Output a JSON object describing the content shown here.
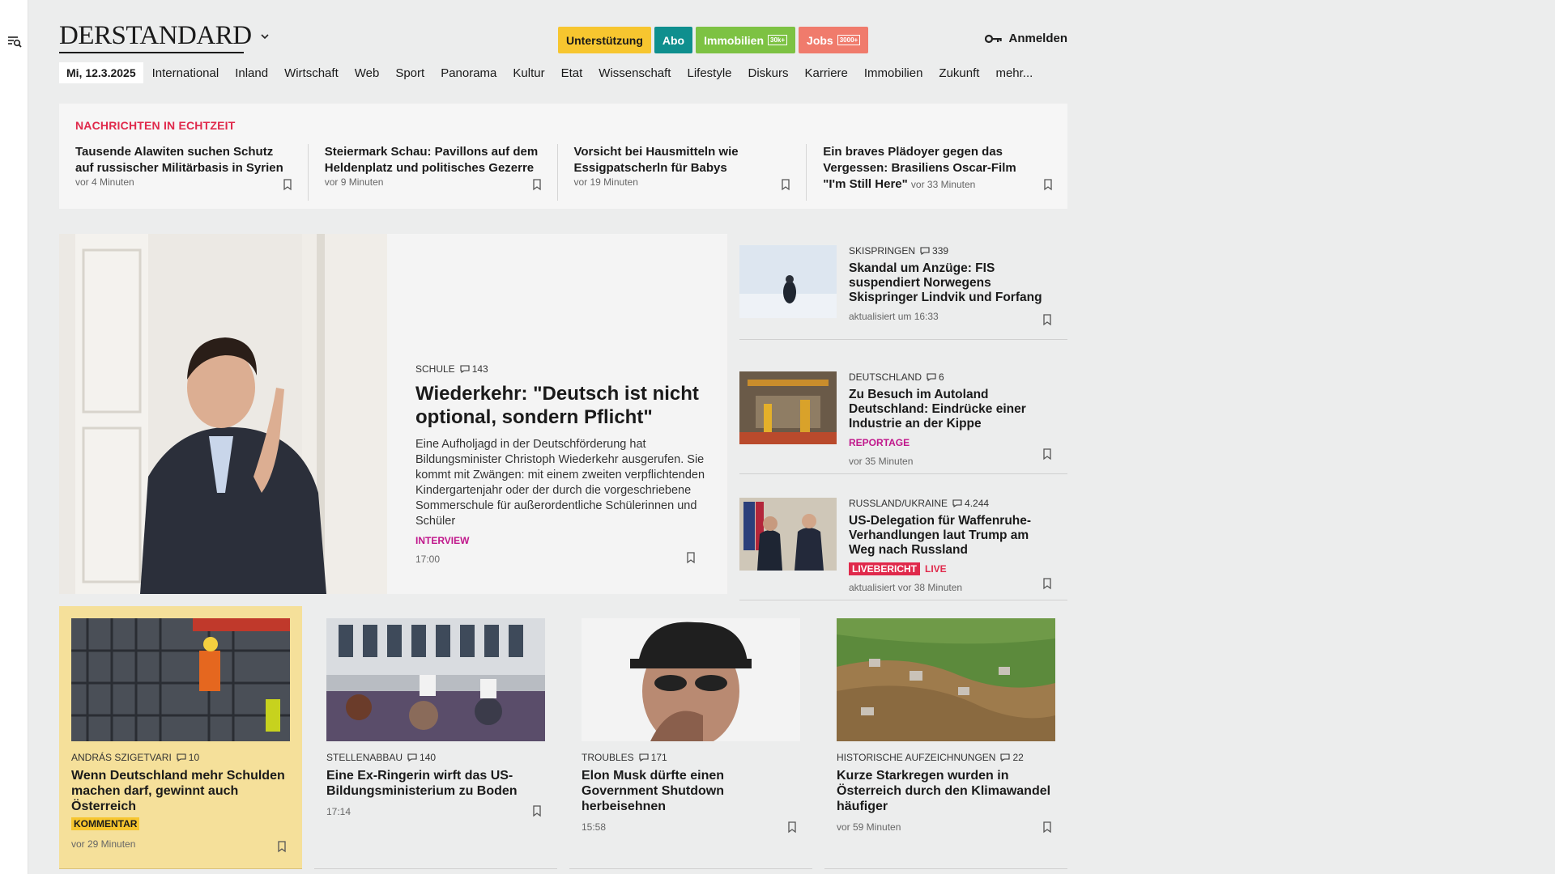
{
  "header": {
    "logo": "DERSTANDARD",
    "pills": [
      {
        "label": "Unterstützung",
        "bg": "#f7c62f",
        "fg": "#1a1a1a",
        "badge": ""
      },
      {
        "label": "Abo",
        "bg": "#0f8f8e",
        "fg": "#ffffff",
        "badge": ""
      },
      {
        "label": "Immobilien",
        "bg": "#7dc243",
        "fg": "#ffffff",
        "badge": "30k+"
      },
      {
        "label": "Jobs",
        "bg": "#f07b6c",
        "fg": "#ffffff",
        "badge": "3000+"
      }
    ],
    "login_label": "Anmelden"
  },
  "nav": {
    "date": "Mi, 12.3.2025",
    "items": [
      "International",
      "Inland",
      "Wirtschaft",
      "Web",
      "Sport",
      "Panorama",
      "Kultur",
      "Etat",
      "Wissenschaft",
      "Lifestyle",
      "Diskurs",
      "Karriere",
      "Immobilien",
      "Zukunft",
      "mehr..."
    ]
  },
  "ticker": {
    "title": "NACHRICHTEN IN ECHTZEIT",
    "items": [
      {
        "title": "Tausende Alawiten suchen Schutz auf russischer Militärbasis in Syrien",
        "time": "vor 4 Minuten"
      },
      {
        "title": "Steiermark Schau: Pavillons auf dem Heldenplatz und politisches Gezerre",
        "time": "vor 9 Minuten"
      },
      {
        "title": "Vorsicht bei Hausmitteln wie Essigpatscherln für Babys",
        "time": "vor 19 Minuten"
      },
      {
        "title": "Ein braves Plädoyer gegen das Vergessen: Brasiliens Oscar-Film \"I'm Still Here\"",
        "time": "vor 33 Minuten"
      }
    ]
  },
  "hero": {
    "kicker": "SCHULE",
    "comments": "143",
    "title": "Wiederkehr: \"Deutsch ist nicht optional, sondern Pflicht\"",
    "desc": "Eine Aufholjagd in der Deutschförderung hat Bildungsminister Christoph Wiederkehr ausgerufen. Sie kommt mit Zwängen: mit einem zweiten verpflichtenden Kindergartenjahr oder der durch die vorgeschriebene Sommerschule für außerordentliche Schülerinnen und Schüler",
    "label": "INTERVIEW",
    "time": "17:00"
  },
  "side": [
    {
      "kicker": "SKISPRINGEN",
      "comments": "339",
      "title": "Skandal um Anzüge: FIS suspendiert Norwegens Skispringer Lindvik und Forfang",
      "label": "",
      "time": "aktualisiert um 16:33"
    },
    {
      "kicker": "DEUTSCHLAND",
      "comments": "6",
      "title": "Zu Besuch im Autoland Deutschland: Eindrücke einer Industrie an der Kippe",
      "label": "REPORTAGE",
      "time": "vor 35 Minuten"
    },
    {
      "kicker": "RUSSLAND/UKRAINE",
      "comments": "4.244",
      "title": "US-Delegation für Waffenruhe-Verhandlungen laut Trump am Weg nach Russland",
      "live_badge": "LIVEBERICHT",
      "live_text": "LIVE",
      "time": "aktualisiert vor 38 Minuten"
    }
  ],
  "cards": [
    {
      "kicker": "ANDRÁS SZIGETVARI",
      "comments": "10",
      "title": "Wenn Deutschland mehr Schulden machen darf, gewinnt auch Österreich",
      "label": "KOMMENTAR",
      "time": "vor 29 Minuten"
    },
    {
      "kicker": "STELLENABBAU",
      "comments": "140",
      "title": "Eine Ex-Ringerin wirft das US-Bildungsministerium zu Boden",
      "time": "17:14"
    },
    {
      "kicker": "TROUBLES",
      "comments": "171",
      "title": "Elon Musk dürfte einen Government Shutdown herbeisehnen",
      "time": "15:58"
    },
    {
      "kicker": "HISTORISCHE AUFZEICHNUNGEN",
      "comments": "22",
      "title": "Kurze Starkregen wurden in Österreich durch den Klimawandel häufiger",
      "time": "vor 59 Minuten"
    }
  ]
}
